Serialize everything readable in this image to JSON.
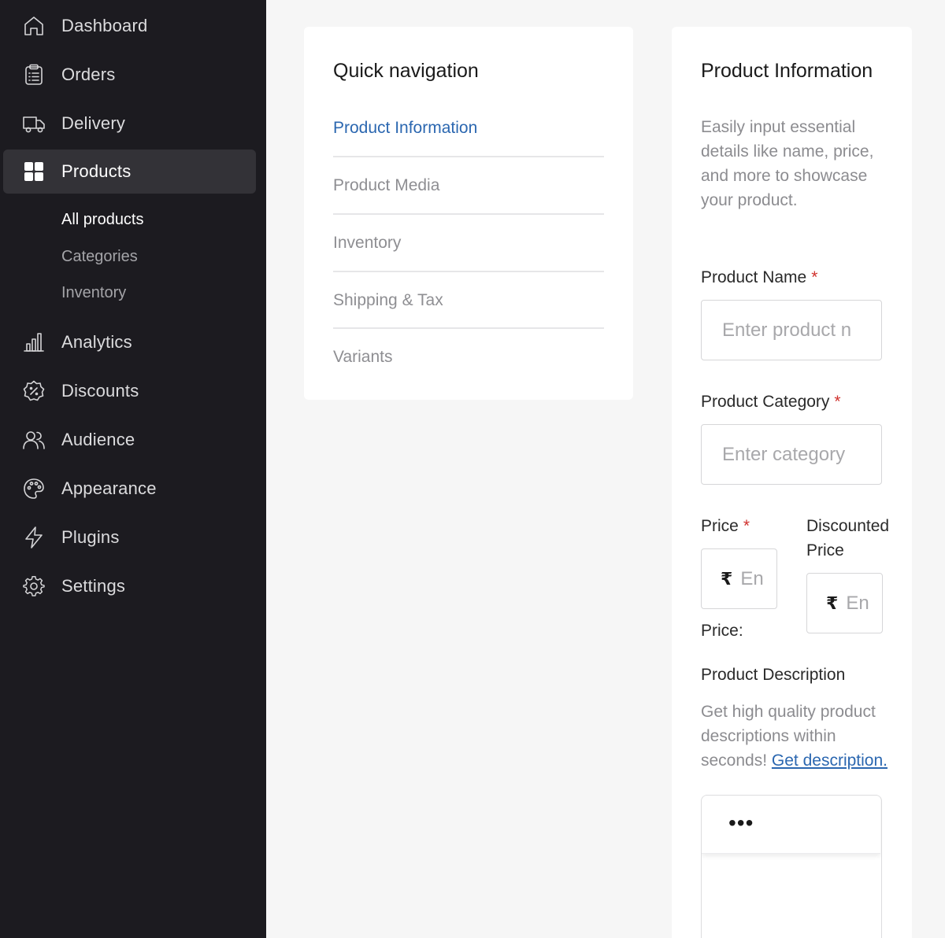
{
  "sidebar": {
    "items": [
      {
        "label": "Dashboard",
        "icon": "home-icon"
      },
      {
        "label": "Orders",
        "icon": "clipboard-list-icon"
      },
      {
        "label": "Delivery",
        "icon": "truck-icon"
      },
      {
        "label": "Products",
        "icon": "grid-icon",
        "active": true
      },
      {
        "label": "Analytics",
        "icon": "bar-chart-icon"
      },
      {
        "label": "Discounts",
        "icon": "discount-badge-icon"
      },
      {
        "label": "Audience",
        "icon": "users-icon"
      },
      {
        "label": "Appearance",
        "icon": "palette-icon"
      },
      {
        "label": "Plugins",
        "icon": "lightning-icon"
      },
      {
        "label": "Settings",
        "icon": "gear-icon"
      }
    ],
    "sub_items": [
      {
        "label": "All products",
        "active": true
      },
      {
        "label": "Categories"
      },
      {
        "label": "Inventory"
      }
    ]
  },
  "quick_nav": {
    "title": "Quick navigation",
    "items": [
      {
        "label": "Product Information",
        "active": true
      },
      {
        "label": "Product Media"
      },
      {
        "label": "Inventory"
      },
      {
        "label": "Shipping & Tax"
      },
      {
        "label": "Variants"
      }
    ]
  },
  "product_info": {
    "title": "Product Information",
    "subtitle": "Easily input essential details like name, price, and more to showcase your product.",
    "name_label": "Product Name",
    "name_placeholder": "Enter product n",
    "category_label": "Product Category",
    "category_placeholder": "Enter category",
    "price_label": "Price",
    "price_currency": "₹",
    "price_placeholder": "En",
    "price_footer": "Price:",
    "discounted_label": "Discounted Price",
    "discounted_currency": "₹",
    "discounted_placeholder": "En",
    "required_mark": "*",
    "description_label": "Product Description",
    "description_text": "Get high quality product descriptions within seconds!",
    "description_link": "Get description.",
    "editor_more": "•••"
  },
  "colors": {
    "sidebar_bg": "#1c1b20",
    "accent": "#2b67b0",
    "required": "#d0312d"
  }
}
